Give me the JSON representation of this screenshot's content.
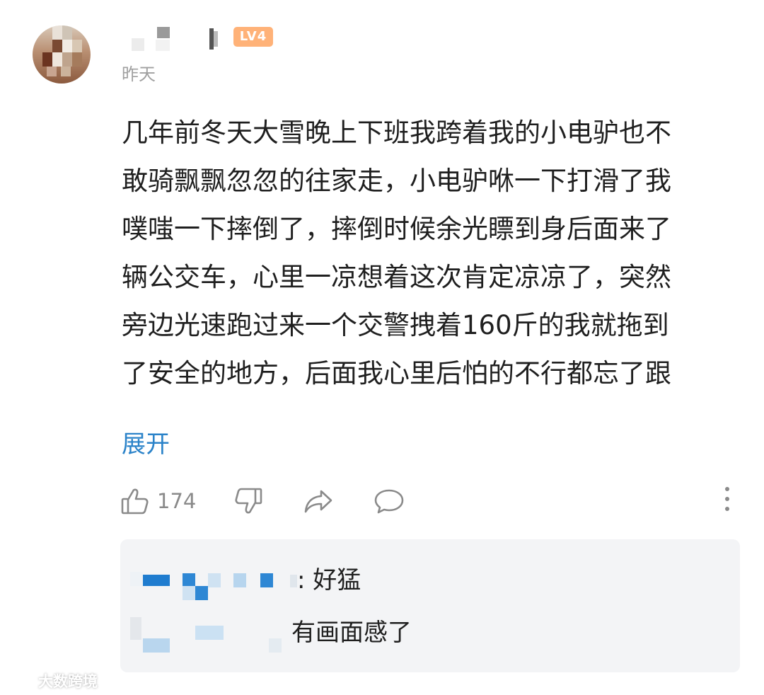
{
  "comment": {
    "level_badge": "LV4",
    "timestamp": "昨天",
    "content_lines": [
      "几年前冬天大雪晚上下班我跨着我的小电驴也不",
      "敢骑飘飘忽忽的往家走，小电驴咻一下打滑了我",
      "噗嗤一下摔倒了，摔倒时候余光瞟到身后面来了",
      "辆公交车，心里一凉想着这次肯定凉凉了，突然",
      "旁边光速跑过来一个交警拽着160斤的我就拖到",
      "了安全的地方，后面我心里后怕的不行都忘了跟"
    ],
    "expand_label": "展开",
    "like_count": "174"
  },
  "icons": {
    "like": "thumbs-up-icon",
    "dislike": "thumbs-down-icon",
    "share": "share-arrow-icon",
    "reply": "speech-bubble-icon",
    "more": "more-vertical-icon"
  },
  "replies": [
    {
      "text": ": 好猛"
    },
    {
      "text": "有画面感了"
    }
  ],
  "watermark": {
    "text": "大数跨境"
  },
  "colors": {
    "link_blue": "#2b83c9",
    "level_badge_orange": "#ffb278",
    "reply_bg": "#f3f4f6",
    "muted_gray": "#8a8a8a"
  }
}
